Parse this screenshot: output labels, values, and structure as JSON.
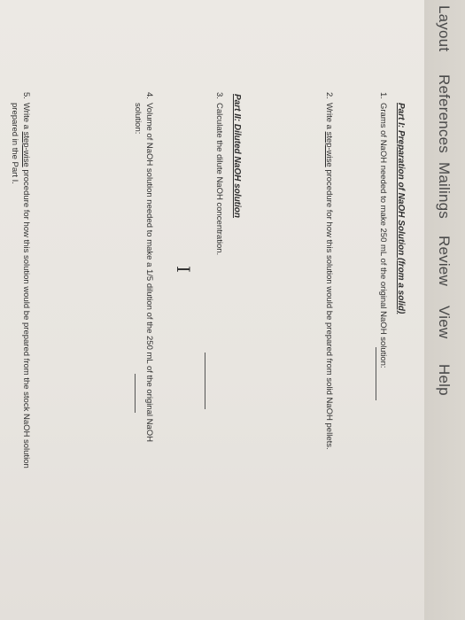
{
  "menu": {
    "layout": "Layout",
    "references": "References",
    "mailings": "Mailings",
    "review": "Review",
    "view": "View",
    "help": "Help"
  },
  "document": {
    "part1_title": "Part I: Preparation of NaOH Solution (from a solid)",
    "q1": {
      "number": "1.",
      "text": "Grams of NaOH needed to make 250 mL of the original NaOH solution:"
    },
    "q2": {
      "number": "2.",
      "pre": "Write a ",
      "link": "step-wise",
      "post": " procedure for how this solution would be prepared from solid NaOH pellets."
    },
    "part2_title": "Part II: Diluted NaOH solution",
    "q3": {
      "number": "3.",
      "text": "Calculate the dilute NaOH concentration."
    },
    "cursor_glyph": "I",
    "q4": {
      "number": "4.",
      "line1": "Volume of NaOH solution needed to make a 1/5 dilution of the 250 mL of the original NaOH",
      "line2": "solution:"
    },
    "q5": {
      "number": "5.",
      "pre": "Write a ",
      "link": "step-wise",
      "post": " procedure for how this solution would be prepared from the stock NaOH solution",
      "line2": "prepared in the Part I."
    }
  }
}
